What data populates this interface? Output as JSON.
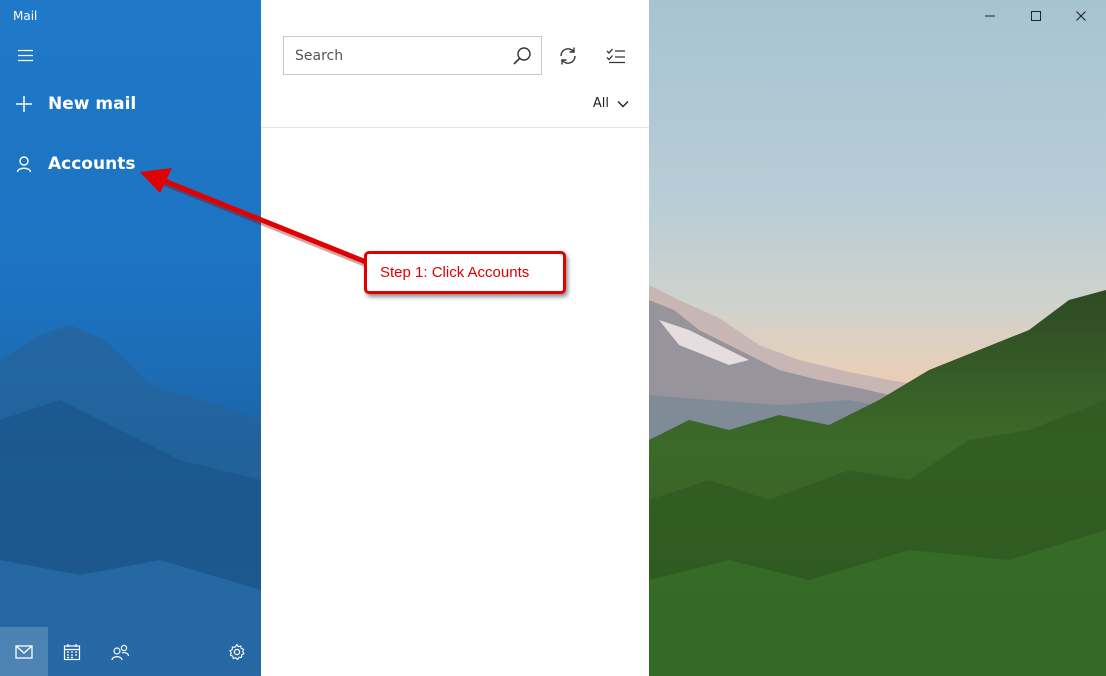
{
  "app": {
    "title": "Mail"
  },
  "sidebar": {
    "new_mail_label": "New mail",
    "accounts_label": "Accounts",
    "bottom_icons": [
      "mail-icon",
      "calendar-icon",
      "people-icon",
      "settings-icon"
    ]
  },
  "list": {
    "search_placeholder": "Search",
    "filter_label": "All"
  },
  "annotation": {
    "text": "Step 1: Click Accounts",
    "color": "#e00000"
  },
  "colors": {
    "sidebar_blue": "#1f78c8",
    "accent_red": "#e00000"
  }
}
